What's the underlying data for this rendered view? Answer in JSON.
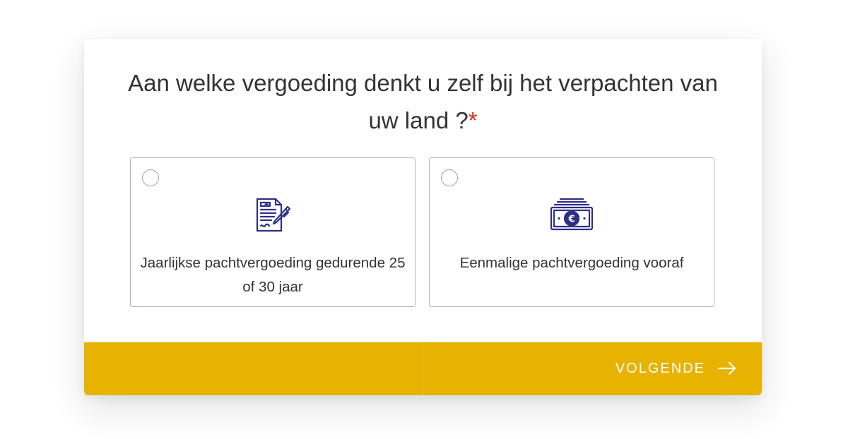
{
  "question": {
    "text": "Aan welke vergoeding denkt u zelf bij het verpachten van uw land ?",
    "required_marker": "*"
  },
  "options": [
    {
      "label": "Jaarlijkse pachtvergoeding gedurende 25 of 30 jaar",
      "icon": "contract-document-icon",
      "selected": false
    },
    {
      "label": "Eenmalige pachtvergoeding vooraf",
      "icon": "euro-banknote-icon",
      "selected": false
    }
  ],
  "footer": {
    "next_label": "VOLGENDE",
    "next_icon": "arrow-right-icon"
  },
  "colors": {
    "accent": "#e8b200",
    "icon": "#2e2f86",
    "required": "#e0261d",
    "text": "#333333",
    "option_border": "#aeb4c9"
  }
}
